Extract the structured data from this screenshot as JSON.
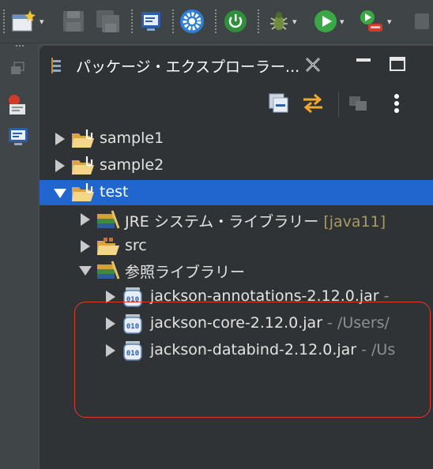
{
  "view": {
    "title": "パッケージ・エクスプローラー...",
    "close_glyph": "✕"
  },
  "toolbar": {
    "items": [
      "new-wizard-icon",
      "save-icon",
      "save-all-icon",
      "terminal-icon",
      "settings-gear-icon",
      "power-icon",
      "debug-icon",
      "run-icon",
      "run-config-icon"
    ],
    "dropdown_glyph": "▾"
  },
  "tree": {
    "items": [
      {
        "label": "sample1",
        "level": 0,
        "expanded": false,
        "icon": "project-folder-icon"
      },
      {
        "label": "sample2",
        "level": 0,
        "expanded": false,
        "icon": "project-folder-icon"
      },
      {
        "label": "test",
        "level": 0,
        "expanded": true,
        "selected": true,
        "icon": "project-folder-icon"
      },
      {
        "label": "JRE システム・ライブラリー",
        "decoration": "[java11]",
        "level": 1,
        "expanded": false,
        "icon": "library-icon"
      },
      {
        "label": "src",
        "level": 1,
        "expanded": false,
        "icon": "source-folder-icon"
      },
      {
        "label": "参照ライブラリー",
        "level": 1,
        "expanded": true,
        "icon": "library-icon"
      },
      {
        "label": "jackson-annotations-2.12.0.jar",
        "suffix": " - ",
        "level": 2,
        "expanded": false,
        "icon": "jar-icon"
      },
      {
        "label": "jackson-core-2.12.0.jar",
        "suffix": " - /Users/",
        "level": 2,
        "expanded": false,
        "icon": "jar-icon"
      },
      {
        "label": "jackson-databind-2.12.0.jar",
        "suffix": " - /Us",
        "level": 2,
        "expanded": false,
        "icon": "jar-icon"
      }
    ]
  },
  "colors": {
    "selection": "#2166cf",
    "highlight_box": "#e03a2f",
    "decoration": "#a89a62"
  }
}
